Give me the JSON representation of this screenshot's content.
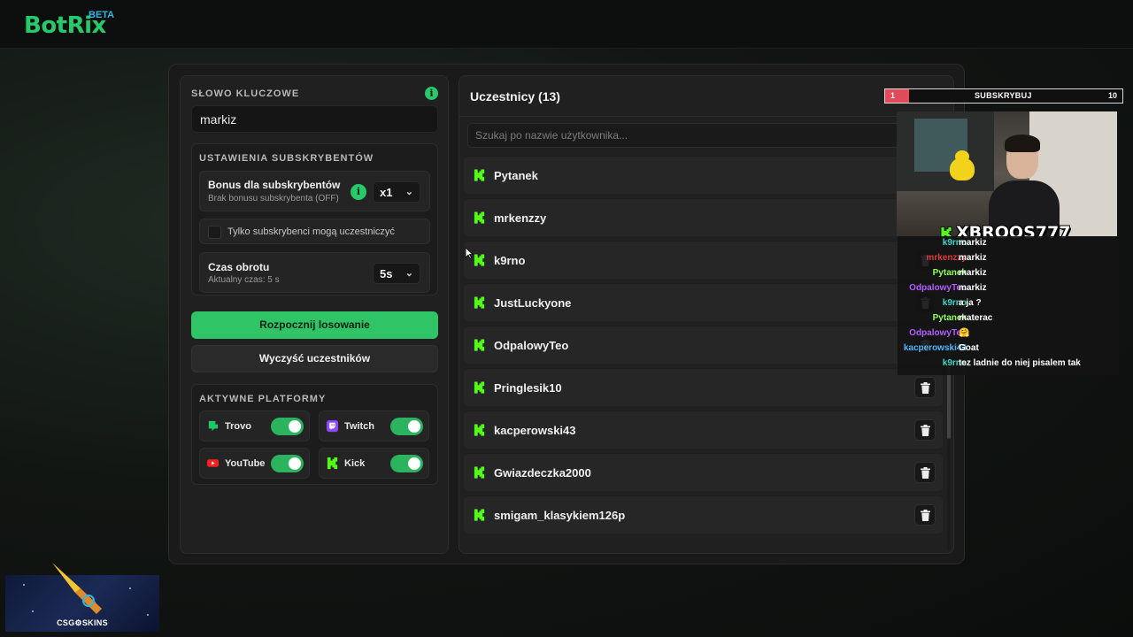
{
  "brand": {
    "name": "BotRix",
    "badge": "BETA"
  },
  "keyword": {
    "label": "SŁOWO KLUCZOWE",
    "value": "markiz"
  },
  "subscribers": {
    "section_label": "USTAWIENIA SUBSKRYBENTÓW",
    "bonus_title": "Bonus dla subskrybentów",
    "bonus_sub": "Brak bonusu subskrybenta (OFF)",
    "bonus_value": "x1",
    "only_subs_label": "Tylko subskrybenci mogą uczestniczyć",
    "spin_title": "Czas obrotu",
    "spin_sub": "Aktualny czas: 5 s",
    "spin_value": "5s"
  },
  "actions": {
    "start_label": "Rozpocznij losowanie",
    "clear_label": "Wyczyść uczestników"
  },
  "platforms": {
    "section_label": "AKTYWNE PLATFORMY",
    "items": [
      {
        "name": "Trovo",
        "enabled": true,
        "color": "#1ec867"
      },
      {
        "name": "Twitch",
        "enabled": true,
        "color": "#9146ff"
      },
      {
        "name": "YouTube",
        "enabled": true,
        "color": "#ff1f1f"
      },
      {
        "name": "Kick",
        "enabled": true,
        "color": "#53fc18"
      }
    ]
  },
  "participants": {
    "title": "Uczestnicy (13)",
    "search_placeholder": "Szukaj po nazwie użytkownika...",
    "items": [
      "Pytanek",
      "mrkenzzy",
      "k9rno",
      "JustLuckyone",
      "OdpalowyTeo",
      "Pringlesik10",
      "kacperowski43",
      "Gwiazdeczka2000",
      "smigam_klasykiem126p"
    ]
  },
  "overlay": {
    "sub_goal": {
      "current": "1",
      "label": "SUBSKRYBUJ",
      "goal": "10",
      "progress": 0.1
    },
    "streamer_name": "XBROOS777",
    "chat": [
      {
        "user": "k9rno",
        "color": "#3fd6c8",
        "msg": "markiz"
      },
      {
        "user": "mrkenzzy",
        "color": "#e03a3a",
        "msg": "markiz"
      },
      {
        "user": "Pytanek",
        "color": "#8dff5a",
        "msg": "markiz"
      },
      {
        "user": "OdpalowyTeo",
        "color": "#b45cff",
        "msg": "markiz"
      },
      {
        "user": "k9rno",
        "color": "#3fd6c8",
        "msg": "a ja ?"
      },
      {
        "user": "Pytanek",
        "color": "#8dff5a",
        "msg": "materac"
      },
      {
        "user": "OdpalowyTeo",
        "color": "#b45cff",
        "msg": "🤗"
      },
      {
        "user": "kacperowski43",
        "color": "#4db7ff",
        "msg": "Goat"
      },
      {
        "user": "k9rno",
        "color": "#3fd6c8",
        "msg": "tez ladnie do niej pisalem tak"
      }
    ]
  },
  "sponsor": {
    "text": "CSG⚙SKINS"
  },
  "colors": {
    "accent": "#27c96a",
    "kick": "#53fc18",
    "panel": "#202020"
  }
}
